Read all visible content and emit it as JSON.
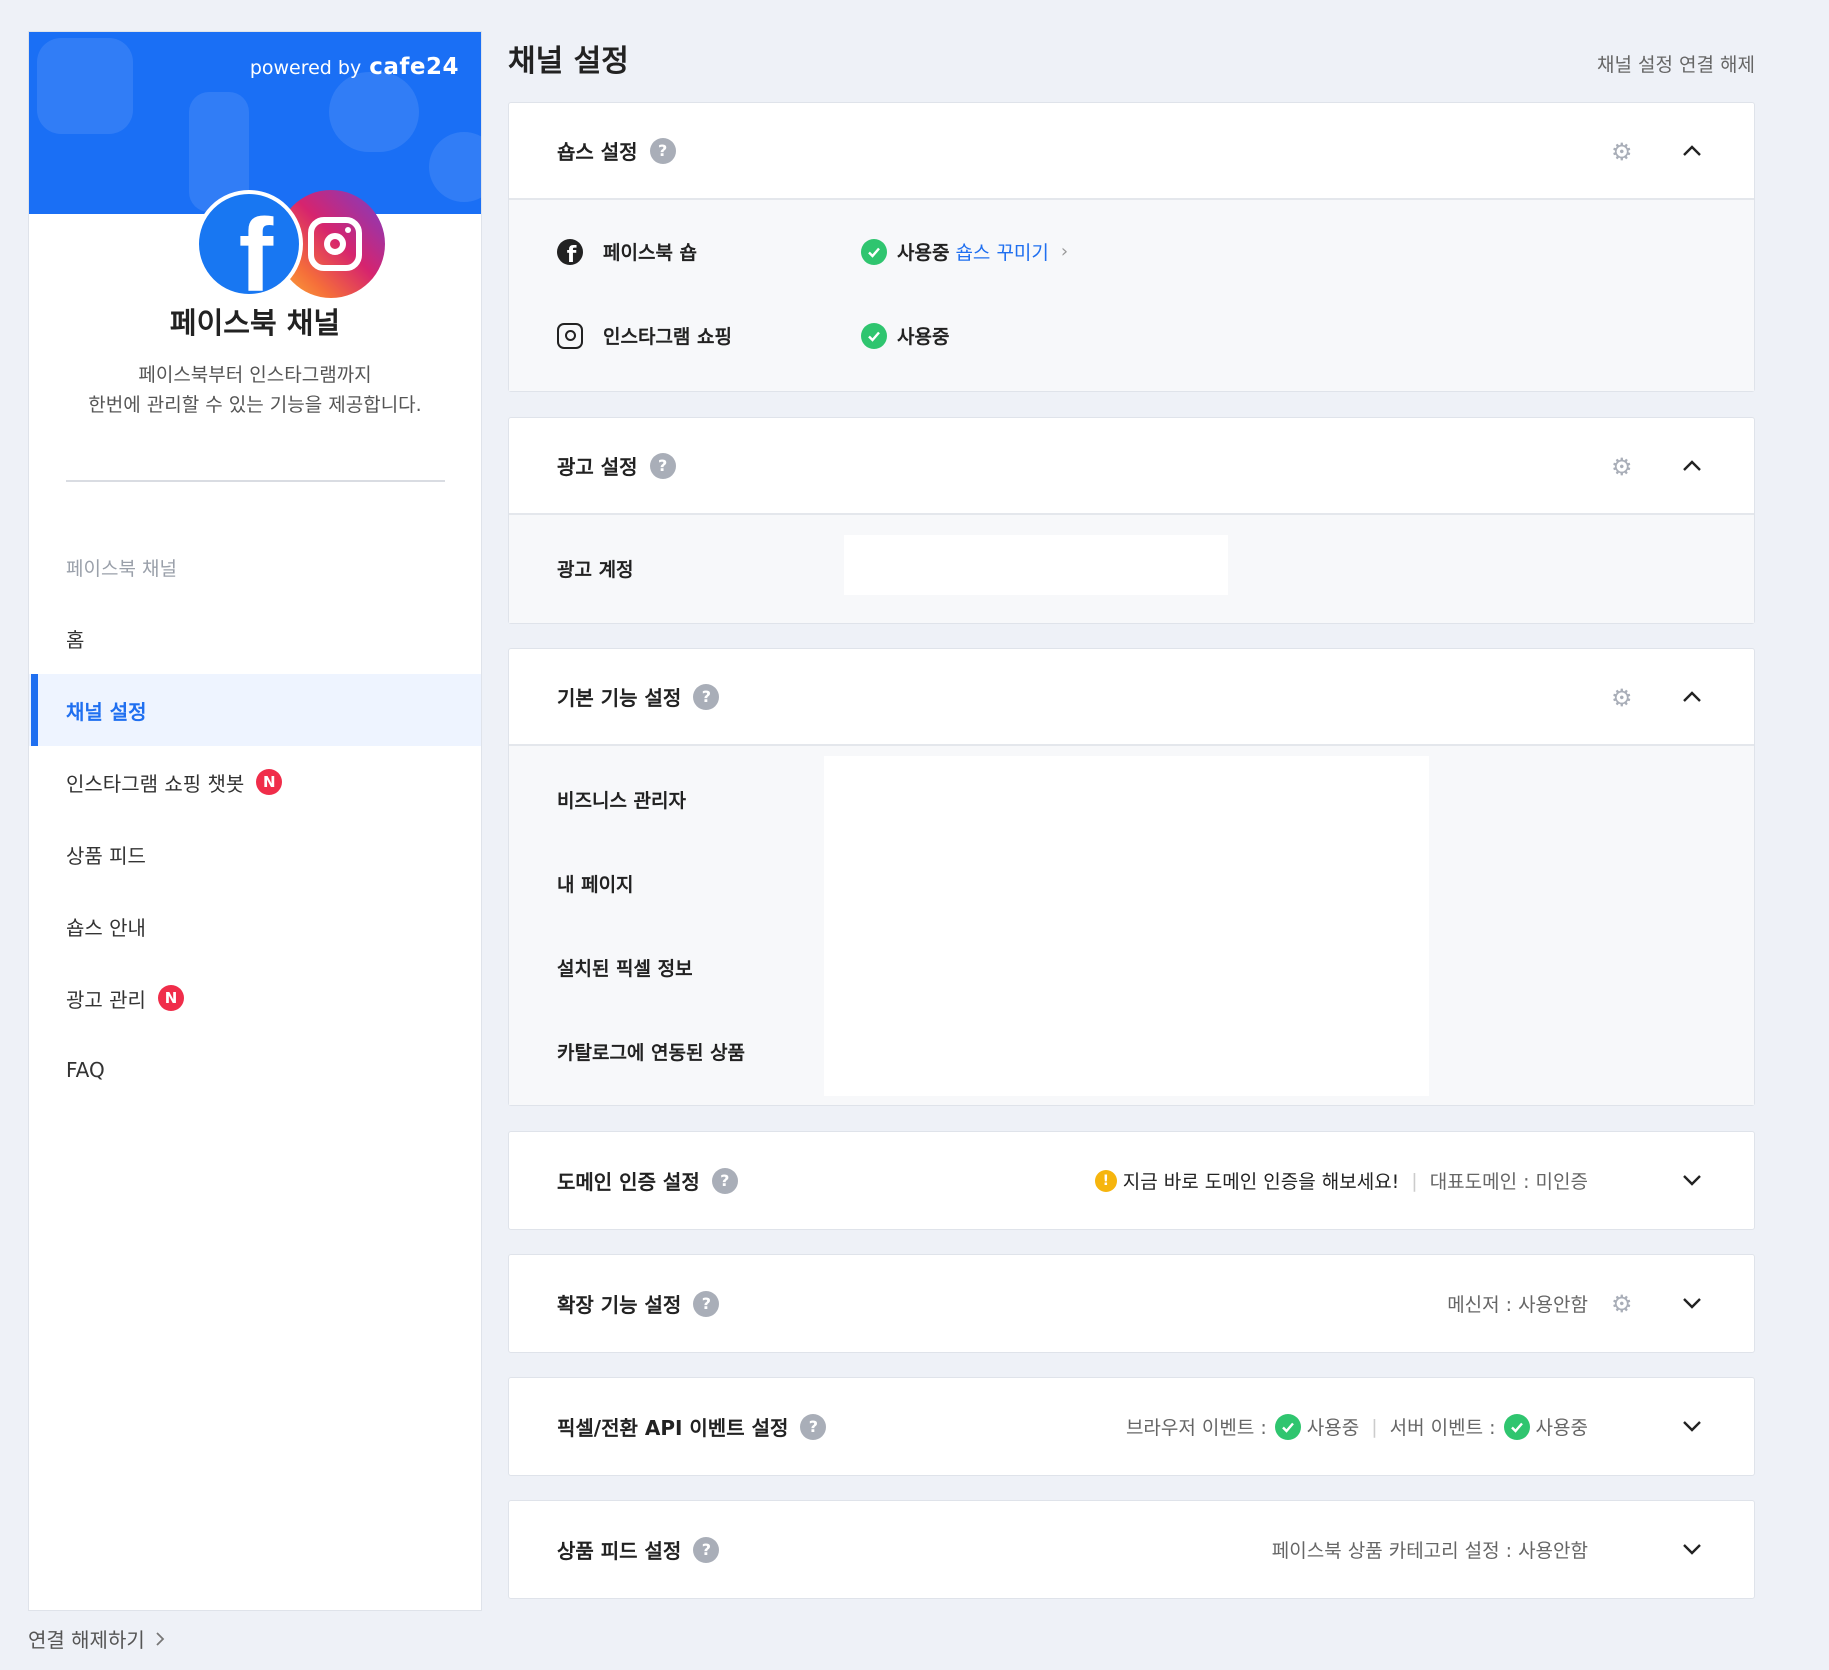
{
  "sidebar": {
    "powered_prefix": "powered by",
    "powered_brand": "cafe24",
    "title": "페이스북 채널",
    "desc_line1": "페이스북부터 인스타그램까지",
    "desc_line2": "한번에 관리할 수 있는 기능을 제공합니다.",
    "section_label": "페이스북 채널",
    "items": [
      {
        "label": "홈"
      },
      {
        "label": "채널 설정"
      },
      {
        "label": "인스타그램 쇼핑 챗봇",
        "badge": "N"
      },
      {
        "label": "상품 피드"
      },
      {
        "label": "숍스 안내"
      },
      {
        "label": "광고 관리",
        "badge": "N"
      },
      {
        "label": "FAQ"
      }
    ],
    "disconnect": "연결 해제하기"
  },
  "main": {
    "title": "채널 설정",
    "top_link": "채널 설정 연결 해제",
    "help": "?",
    "shops": {
      "title": "숍스 설정",
      "rows": [
        {
          "label": "페이스북 숍",
          "status": "사용중",
          "link": "숍스 꾸미기"
        },
        {
          "label": "인스타그램 쇼핑",
          "status": "사용중"
        }
      ]
    },
    "ads": {
      "title": "광고 설정",
      "account_label": "광고 계정"
    },
    "basic": {
      "title": "기본 기능 설정",
      "rows": [
        "비즈니스 관리자",
        "내 페이지",
        "설치된 픽셀 정보",
        "카탈로그에 연동된 상품"
      ]
    },
    "domain": {
      "title": "도메인 인증 설정",
      "warn_icon": "!",
      "warn_text": "지금 바로 도메인 인증을 해보세요!",
      "label": "대표도메인 :",
      "value": "미인증"
    },
    "extension": {
      "title": "확장 기능 설정",
      "label": "메신저 :",
      "value": "사용안함"
    },
    "pixel": {
      "title": "픽셀/전환 API 이벤트 설정",
      "browser_label": "브라우저 이벤트 :",
      "browser_value": "사용중",
      "server_label": "서버 이벤트 :",
      "server_value": "사용중"
    },
    "feed": {
      "title": "상품 피드 설정",
      "label": "페이스북 상품 카테고리 설정 :",
      "value": "사용안함"
    }
  },
  "colors": {
    "accent": "#1f6ff0",
    "banner": "#1a6ff5",
    "success": "#2fc56f",
    "badge": "#f02d4a",
    "warning": "#f6b50e"
  },
  "icons": [
    "facebook-icon",
    "instagram-icon",
    "help-icon",
    "gear-icon",
    "chevron-up-icon",
    "chevron-down-icon",
    "check-icon",
    "warning-icon"
  ]
}
